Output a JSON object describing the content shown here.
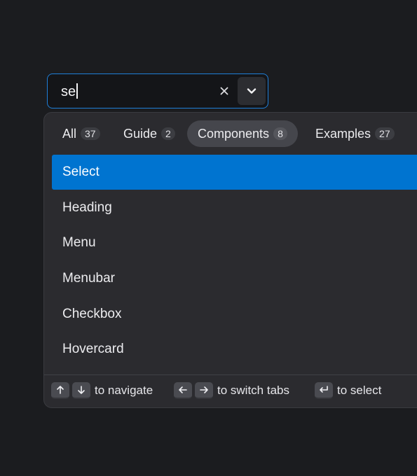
{
  "search": {
    "value": "se",
    "clear_icon": "close-icon",
    "toggle_icon": "chevron-down-icon"
  },
  "tabs": [
    {
      "label": "All",
      "count": "37"
    },
    {
      "label": "Guide",
      "count": "2"
    },
    {
      "label": "Components",
      "count": "8"
    },
    {
      "label": "Examples",
      "count": "27"
    }
  ],
  "active_tab": "Components",
  "options": [
    {
      "label": "Select"
    },
    {
      "label": "Heading"
    },
    {
      "label": "Menu"
    },
    {
      "label": "Menubar"
    },
    {
      "label": "Checkbox"
    },
    {
      "label": "Hovercard"
    }
  ],
  "selected_option": "Select",
  "footer": {
    "navigate": "to navigate",
    "switch": "to switch tabs",
    "select": "to select"
  },
  "colors": {
    "accent": "#0074d0",
    "focus_border": "#1f7fd8",
    "background": "#1b1c1f",
    "popover": "#2b2b2f"
  }
}
